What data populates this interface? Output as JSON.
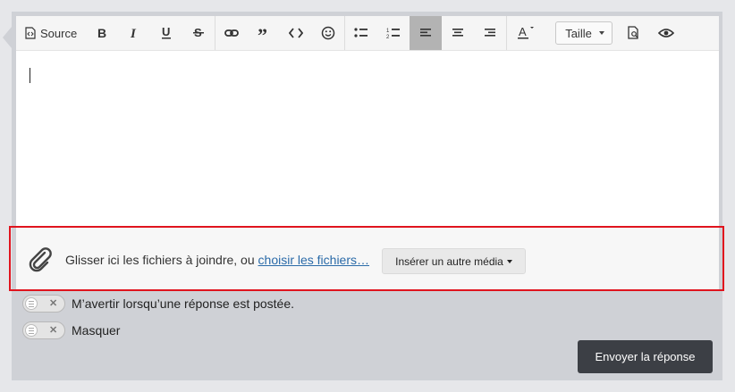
{
  "toolbar": {
    "source_label": "Source",
    "size_label": "Taille",
    "buttons": [
      "source",
      "bold",
      "italic",
      "underline",
      "strikethrough",
      "link",
      "quote",
      "code",
      "smiley",
      "bulleted-list",
      "numbered-list",
      "align-left",
      "align-center",
      "align-right",
      "text-color",
      "size",
      "preview",
      "view"
    ],
    "active_button": "align-left"
  },
  "attachments": {
    "text": "Glisser ici les fichiers à joindre, ou ",
    "link": "choisir les fichiers…",
    "media_button": "Insérer un autre média"
  },
  "options": {
    "notify_label": "M’avertir lorsqu’une réponse est postée.",
    "hide_label": "Masquer"
  },
  "submit_label": "Envoyer la réponse",
  "colors": {
    "highlight_border": "#e0141e",
    "link": "#2a6aa8",
    "submit_bg": "#3c3f45"
  }
}
